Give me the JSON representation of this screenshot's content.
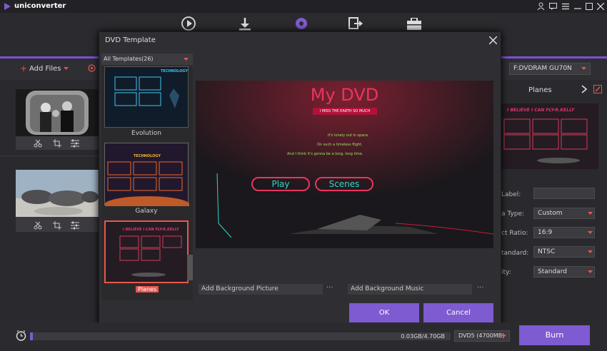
{
  "app": {
    "title": "uniconverter"
  },
  "toolbar": {
    "add_files_label": "Add Files",
    "output_path": "F:DVDRAM GU70N"
  },
  "right_panel": {
    "template_name": "Planes",
    "fields": [
      {
        "label": "Label:",
        "value": ""
      },
      {
        "label": "a Type:",
        "value": "Custom"
      },
      {
        "label": "ct Ratio:",
        "value": "16:9"
      },
      {
        "label": "tandard:",
        "value": "NTSC"
      },
      {
        "label": "ity:",
        "value": "Standard"
      }
    ],
    "thumb_title": "I BELIEVE I CAN FLY-R.KELLY"
  },
  "modal": {
    "title": "DVD Template",
    "filter_label": "All Templates(26)",
    "templates": [
      {
        "name": "Evolution",
        "tag": "TECHNOLOGY"
      },
      {
        "name": "Galaxy",
        "tag": "TECHNOLOGY"
      },
      {
        "name": "Planes",
        "tag": "I BELIEVE I CAN FLY-R.KELLY"
      }
    ],
    "preview": {
      "title": "My DVD",
      "subtitle": "I MISS THE EARTH SO MUCH",
      "lines": [
        "It's lonely out in space.",
        "On such a timeless flight.",
        "And I think it's gonna be a long, long time."
      ],
      "play_label": "Play",
      "scenes_label": "Scenes"
    },
    "bg_picture_label": "Add Background Picture",
    "bg_music_label": "Add Background Music",
    "ok_label": "OK",
    "cancel_label": "Cancel"
  },
  "bottom": {
    "size_text": "0.03GB/4.70GB",
    "disc_type": "DVD5 (4700MB)",
    "burn_label": "Burn",
    "progress_fraction": 0.006
  },
  "colors": {
    "accent": "#7e5bd0",
    "highlight": "#e8564c",
    "pink_text": "#e0346e"
  }
}
